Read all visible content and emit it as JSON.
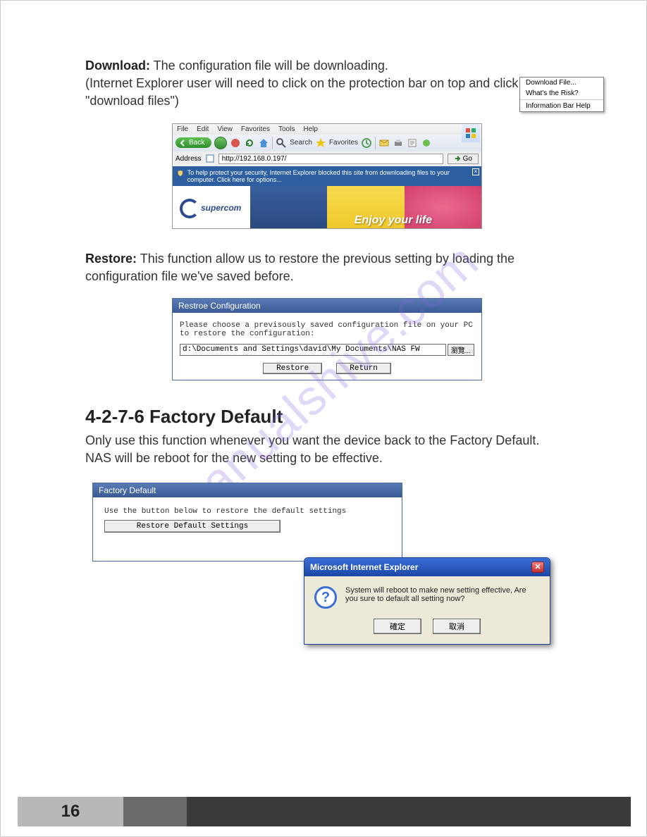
{
  "download": {
    "label": "Download:",
    "text": " The configuration file will be downloading.",
    "note": "(Internet Explorer user will need to click on the protection bar on top and click choose \"download files\")"
  },
  "ie": {
    "menu": {
      "file": "File",
      "edit": "Edit",
      "view": "View",
      "favorites": "Favorites",
      "tools": "Tools",
      "help": "Help"
    },
    "back": "Back",
    "search": "Search",
    "favoritesBtn": "Favorites",
    "addressLabel": "Address",
    "addressValue": "http://192.168.0.197/",
    "go": "Go",
    "infobar": "To help protect your security, Internet Explorer blocked this site from downloading files to your computer. Click here for options...",
    "ctx": {
      "download": "Download File...",
      "risk": "What's the Risk?",
      "help": "Information Bar Help"
    },
    "logo": "supercom",
    "enjoy": "Enjoy your life"
  },
  "restore": {
    "label": "Restore:",
    "text": " This function allow us to restore the previous setting by loading the configuration file we've saved before.",
    "panelTitle": "Restroe Configuration",
    "desc": "Please choose a previsously saved configuration file on your PC to restore the configuration:",
    "path": "d:\\Documents and Settings\\david\\My Documents\\NAS FW",
    "browse": "瀏覽...",
    "btnRestore": "Restore",
    "btnReturn": "Return"
  },
  "factory": {
    "heading": "4-2-7-6  Factory Default",
    "text": "Only use this function whenever you want the device back to the Factory Default. NAS will be reboot for the new setting to be effective.",
    "panelTitle": "Factory Default",
    "desc": "Use the button below to restore the default settings",
    "btn": "Restore Default Settings"
  },
  "dialog": {
    "title": "Microsoft Internet Explorer",
    "msg": "System will reboot to make new setting effective, Are you sure to default all setting now?",
    "ok": "確定",
    "cancel": "取消"
  },
  "watermark": "manualshive.com",
  "pageNumber": "16"
}
